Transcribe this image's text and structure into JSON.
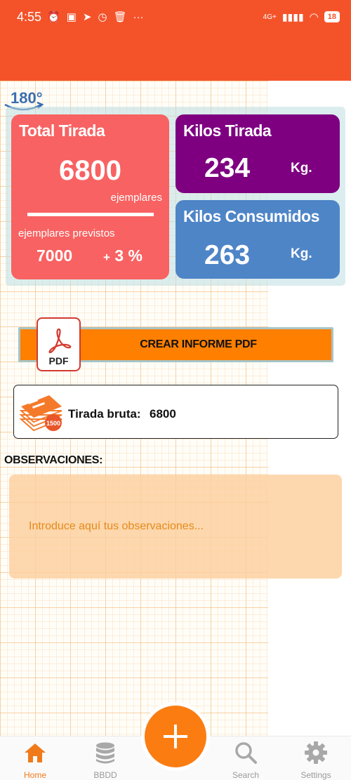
{
  "status_bar": {
    "time": "4:55",
    "network": "4G+",
    "battery": "18"
  },
  "logo": {
    "text": "180°"
  },
  "total_card": {
    "title": "Total Tirada",
    "value": "6800",
    "unit": "ejemplares",
    "expected_label": "ejemplares previstos",
    "expected_value": "7000",
    "percent_sign": "+",
    "percent_value": "3 %"
  },
  "kilos_card": {
    "title": "Kilos Tirada",
    "value": "234",
    "unit": "Kg."
  },
  "consumed_card": {
    "title": "Kilos Consumidos",
    "value": "263",
    "unit": "Kg."
  },
  "pdf": {
    "button_label": "CREAR INFORME PDF",
    "icon_label": "PDF"
  },
  "tirada_bruta": {
    "label": "Tirada bruta:",
    "value": "6800",
    "icon_badge": "1500"
  },
  "observaciones": {
    "title": "OBSERVACIONES:",
    "placeholder": "Introduce aquí tus observaciones..."
  },
  "bottom_nav": {
    "items": [
      {
        "label": "Home",
        "icon": "home-icon",
        "active": true
      },
      {
        "label": "BBDD",
        "icon": "database-icon",
        "active": false
      },
      {
        "label": "Search",
        "icon": "search-icon",
        "active": false
      },
      {
        "label": "Settings",
        "icon": "gear-icon",
        "active": false
      }
    ],
    "fab_icon": "plus-icon"
  },
  "colors": {
    "app_bar": "#f4532a",
    "total_card": "#f86262",
    "kilos_card": "#7e0081",
    "consumed_card": "#4e85c7",
    "accent": "#ff7f00"
  }
}
